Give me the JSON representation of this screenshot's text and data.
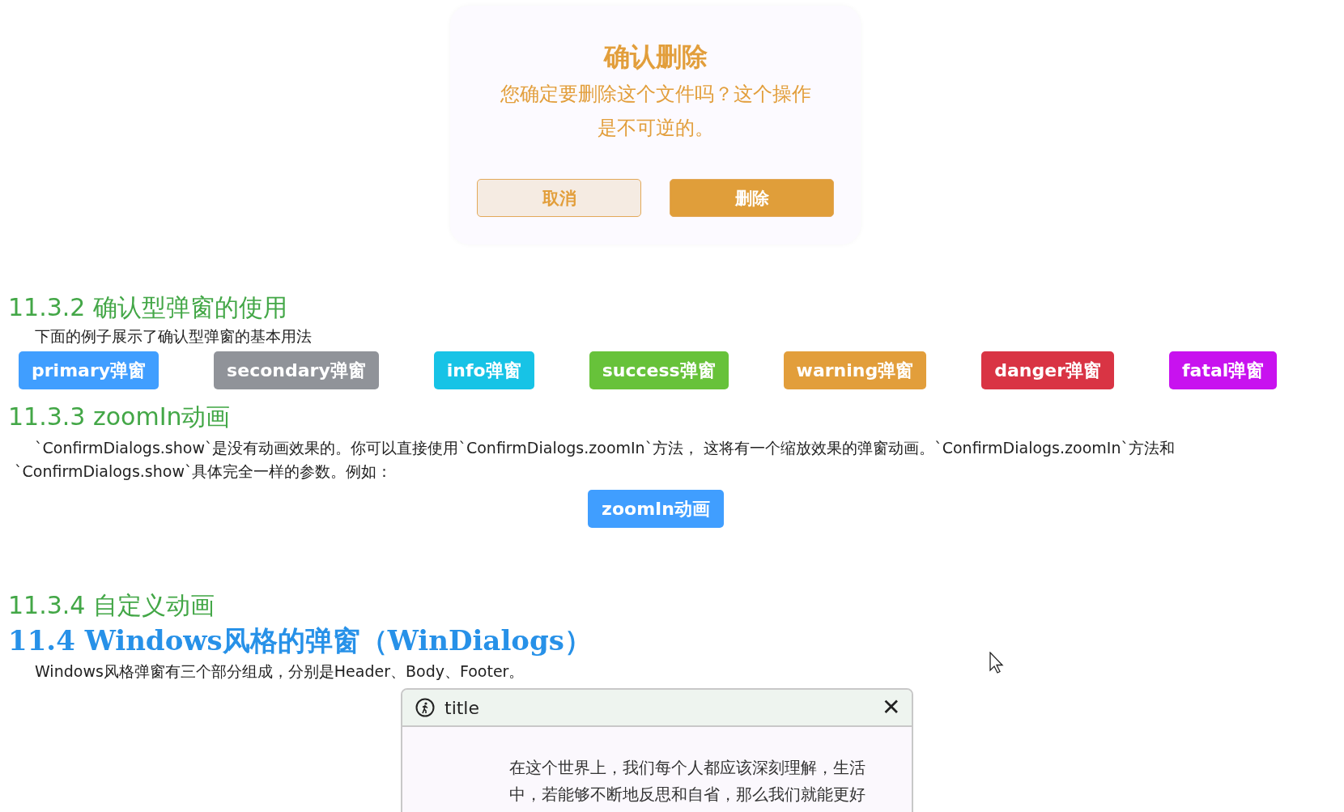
{
  "confirm_dialog": {
    "title": "确认删除",
    "message_lines": [
      "您确定要删除这个文件吗？这个操作",
      "是不可逆的。"
    ],
    "buttons": [
      {
        "label": "取消",
        "kind": "cancel"
      },
      {
        "label": "删除",
        "kind": "confirm"
      }
    ]
  },
  "section_11_3_2": {
    "heading": "11.3.2 确认型弹窗的使用",
    "description": "下面的例子展示了确认型弹窗的基本用法",
    "buttons": [
      {
        "label": "primary弹窗",
        "color": "#409eff"
      },
      {
        "label": "secondary弹窗",
        "color": "#909399"
      },
      {
        "label": "info弹窗",
        "color": "#17c3e6"
      },
      {
        "label": "success弹窗",
        "color": "#67c23a"
      },
      {
        "label": "warning弹窗",
        "color": "#e29e3b"
      },
      {
        "label": "danger弹窗",
        "color": "#d93444"
      },
      {
        "label": "fatal弹窗",
        "color": "#c812ef"
      }
    ]
  },
  "section_11_3_3": {
    "heading": "11.3.3 zoomIn动画",
    "paragraph_lines": [
      "`ConfirmDialogs.show`是没有动画效果的。你可以直接使用`ConfirmDialogs.zoomIn`方法， 这将有一个缩放效果的弹窗动画。`ConfirmDialogs.zoomIn`方法和",
      "`ConfirmDialogs.show`具体完全一样的参数。例如："
    ],
    "button": "zoomIn动画"
  },
  "section_11_3_4": {
    "heading": "11.3.4 自定义动画"
  },
  "section_11_4": {
    "heading": "11.4 Windows风格的弹窗（WinDialogs）",
    "description": "Windows风格弹窗有三个部分组成，分别是Header、Body、Footer。",
    "window": {
      "title": "title",
      "close": "✕",
      "body_lines": [
        "在这个世界上，我们每个人都应该深刻理解，生活",
        "中，若能够不断地反思和自省，那么我们就能更好"
      ]
    }
  }
}
